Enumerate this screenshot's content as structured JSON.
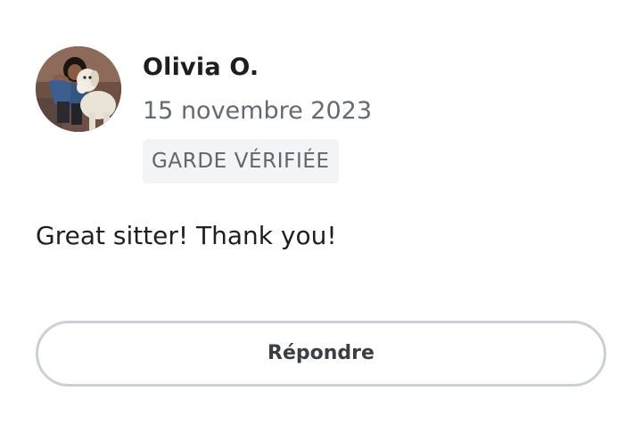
{
  "review": {
    "reviewer_name": "Olivia O.",
    "date": "15 novembre 2023",
    "badge": "GARDE VÉRIFIÉE",
    "text": "Great sitter! Thank you!",
    "reply_label": "Répondre",
    "avatar_icon": "profile-photo-person-with-dog"
  },
  "colors": {
    "name": "#1e1e22",
    "muted": "#636a72",
    "badge_bg": "#f3f4f6",
    "button_border": "#c9d0d6"
  }
}
